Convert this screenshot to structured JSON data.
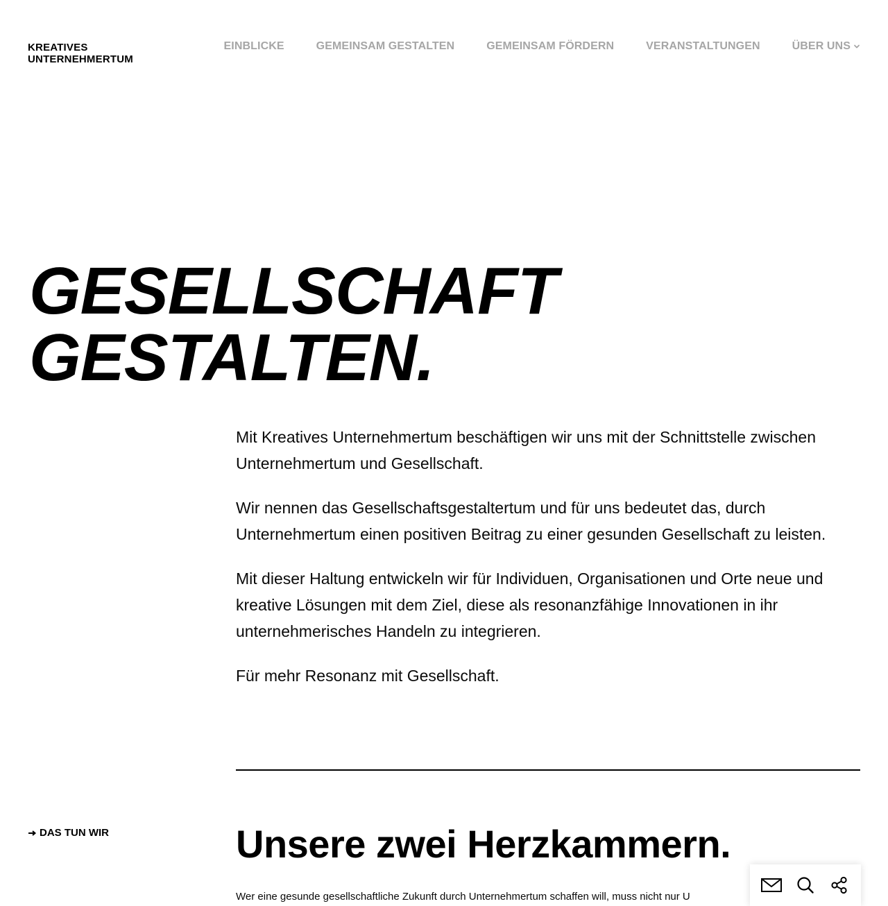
{
  "header": {
    "logo_line1": "KREATIVES",
    "logo_line2": "UNTERNEHMERTUM",
    "nav": [
      {
        "label": "EINBLICKE"
      },
      {
        "label": "GEMEINSAM GESTALTEN"
      },
      {
        "label": "GEMEINSAM FÖRDERN"
      },
      {
        "label": "VERANSTALTUNGEN"
      },
      {
        "label": "ÜBER UNS",
        "icon": "chevron-down-icon"
      }
    ],
    "nav_color": "#a6a6a6"
  },
  "hero": {
    "line1": "GESELLSCHAFT",
    "line2": "GESTALTEN."
  },
  "intro": {
    "paragraphs": [
      "Mit Kreatives Unternehmertum beschäftigen wir uns mit der Schnittstelle zwischen Unternehmertum und Gesellschaft.",
      "Wir nennen das Gesellschaftsgestaltertum und für uns bedeutet das, durch Unternehmertum einen positiven Beitrag zu einer gesunden Gesellschaft zu leisten.",
      "Mit dieser Haltung entwickeln wir für Individuen, Organisationen und Orte neue und kreative Lösungen mit dem Ziel, diese als resonanzfähige Innovationen in ihr unternehmerisches Handeln zu integrieren.",
      "Für mehr Resonanz mit Gesellschaft."
    ]
  },
  "section": {
    "label": "DAS TUN WIR",
    "label_icon": "arrow-right-icon",
    "heading": "Unsere zwei Herzkammern.",
    "text": "Wer eine gesunde gesellschaftliche Zukunft durch Unternehmertum schaffen will, muss nicht nur U"
  },
  "action_bar": {
    "icons": [
      "mail-icon",
      "search-icon",
      "share-icon"
    ]
  }
}
